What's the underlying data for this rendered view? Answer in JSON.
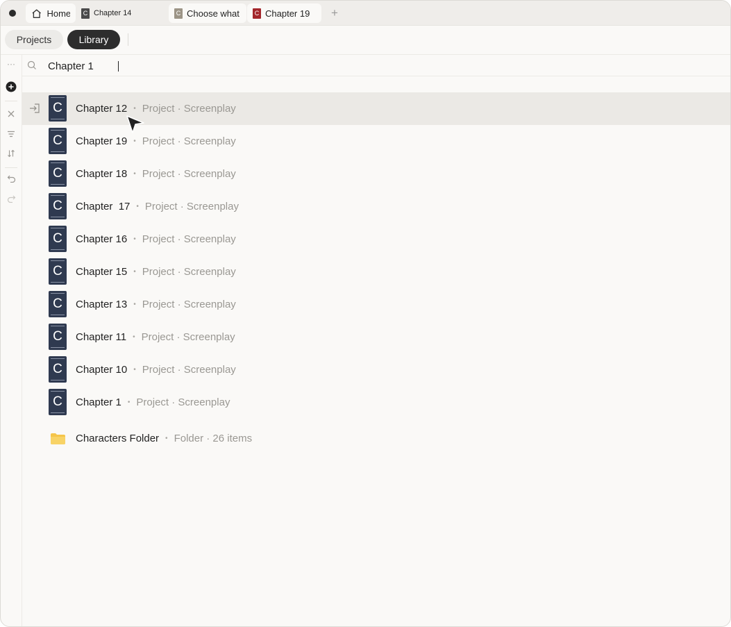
{
  "tabs": {
    "home": "Home",
    "tab2": "Chapter 14",
    "tab3": "Choose what",
    "tab4": "Chapter 19",
    "new_tab": "+",
    "tab_icon_letter": "C"
  },
  "nav": {
    "projects": "Projects",
    "library": "Library"
  },
  "rail": {
    "more": "···"
  },
  "search": {
    "value": "Chapter 1"
  },
  "results": [
    {
      "title": "Chapter 12",
      "meta": "Project · Screenplay",
      "icon_letter": "C"
    },
    {
      "title": "Chapter 19",
      "meta": "Project · Screenplay",
      "icon_letter": "C"
    },
    {
      "title": "Chapter 18",
      "meta": "Project · Screenplay",
      "icon_letter": "C"
    },
    {
      "title": "Chapter  17",
      "meta": "Project · Screenplay",
      "icon_letter": "C"
    },
    {
      "title": "Chapter 16",
      "meta": "Project · Screenplay",
      "icon_letter": "C"
    },
    {
      "title": "Chapter 15",
      "meta": "Project · Screenplay",
      "icon_letter": "C"
    },
    {
      "title": "Chapter 13",
      "meta": "Project · Screenplay",
      "icon_letter": "C"
    },
    {
      "title": "Chapter 11",
      "meta": "Project · Screenplay",
      "icon_letter": "C"
    },
    {
      "title": "Chapter 10",
      "meta": "Project · Screenplay",
      "icon_letter": "C"
    },
    {
      "title": "Chapter 1",
      "meta": "Project · Screenplay",
      "icon_letter": "C"
    }
  ],
  "folder": {
    "title": "Characters Folder",
    "meta": "Folder · 26 items"
  },
  "separator": "•",
  "colors": {
    "doc_icon": "#2f3a50",
    "highlight": "#ebe9e5",
    "folder": "#f5c54a"
  }
}
